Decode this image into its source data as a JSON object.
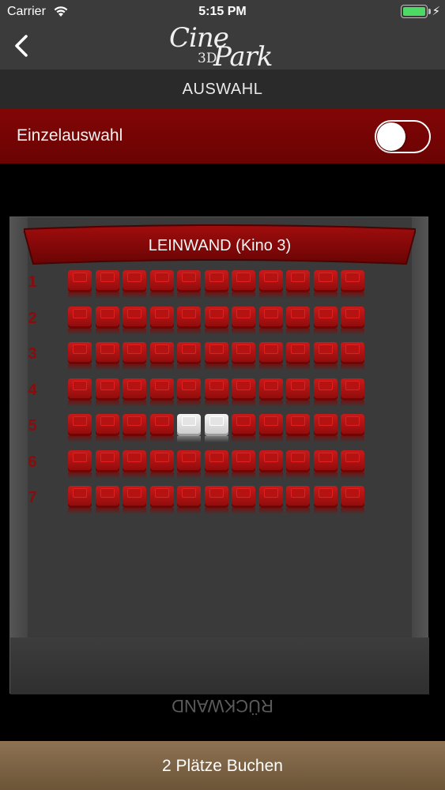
{
  "status_bar": {
    "carrier": "Carrier",
    "time": "5:15 PM",
    "wifi_icon": "wifi-icon",
    "battery_icon": "battery-icon",
    "charging_icon": "bolt-icon"
  },
  "nav": {
    "back_icon": "chevron-left-icon",
    "logo": {
      "cine": "Cine",
      "park": "Park",
      "d3": "3D"
    }
  },
  "subheader": {
    "title": "AUSWAHL"
  },
  "single_selection": {
    "label": "Einzelauswahl",
    "toggle_on": false
  },
  "hall": {
    "screen_label": "LEINWAND (Kino 3)",
    "back_wall_label": "RÜCKWAND",
    "rows": [
      {
        "label": "1",
        "seats": [
          "free",
          "free",
          "free",
          "free",
          "free",
          "free",
          "free",
          "free",
          "free",
          "free",
          "free"
        ]
      },
      {
        "label": "2",
        "seats": [
          "free",
          "free",
          "free",
          "free",
          "free",
          "free",
          "free",
          "free",
          "free",
          "free",
          "free"
        ]
      },
      {
        "label": "3",
        "seats": [
          "free",
          "free",
          "free",
          "free",
          "free",
          "free",
          "free",
          "free",
          "free",
          "free",
          "free"
        ]
      },
      {
        "label": "4",
        "seats": [
          "free",
          "free",
          "free",
          "free",
          "free",
          "free",
          "free",
          "free",
          "free",
          "free",
          "free"
        ]
      },
      {
        "label": "5",
        "seats": [
          "free",
          "free",
          "free",
          "free",
          "selected",
          "selected",
          "free",
          "free",
          "free",
          "free",
          "free"
        ]
      },
      {
        "label": "6",
        "seats": [
          "free",
          "free",
          "free",
          "free",
          "free",
          "free",
          "free",
          "free",
          "free",
          "free",
          "free"
        ]
      },
      {
        "label": "7",
        "seats": [
          "free",
          "free",
          "free",
          "free",
          "free",
          "free",
          "free",
          "free",
          "free",
          "free",
          "free"
        ]
      }
    ]
  },
  "colors": {
    "nav_bar": "#3b3b3b",
    "accent_red": "#820606",
    "seat_free": "#c71a1a",
    "seat_selected": "#f4f4f4",
    "book_button": "#8e7353"
  },
  "book_button": {
    "label": "2 Plätze Buchen"
  }
}
